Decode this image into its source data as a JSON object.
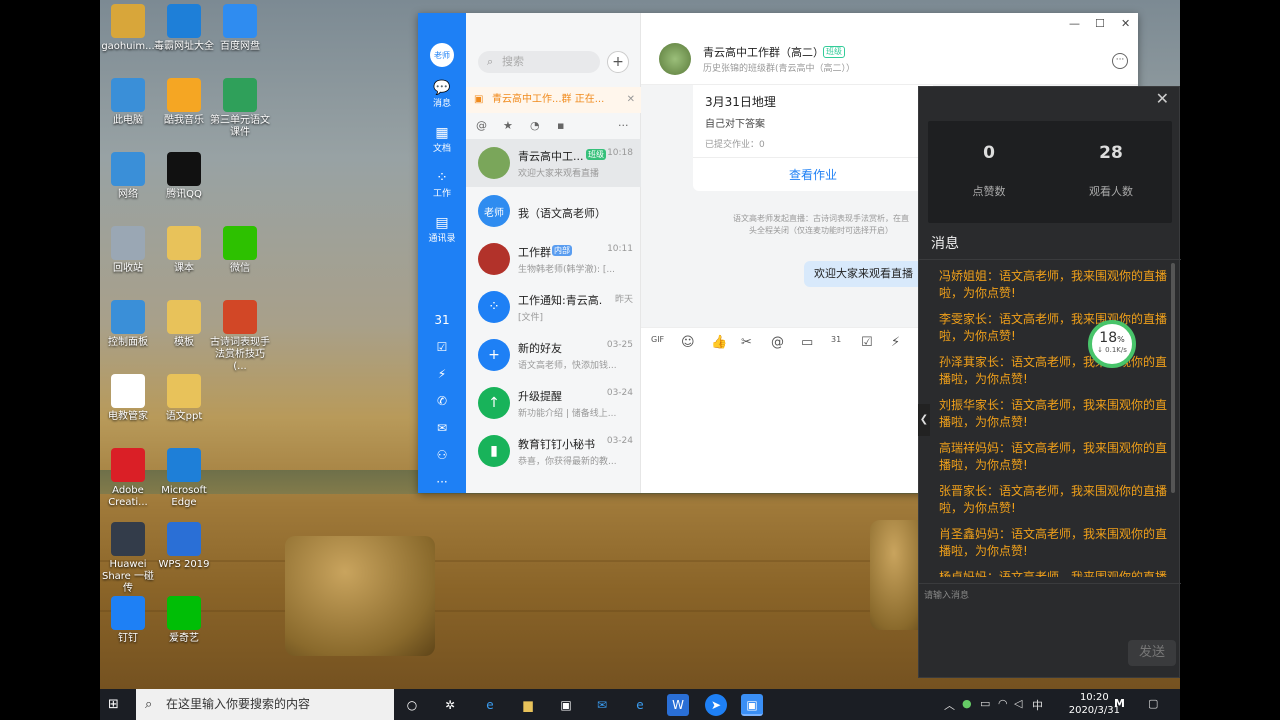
{
  "desktop_icons": [
    {
      "label": "gaohuim...",
      "icon": "user-folder-icon",
      "color": "#d8a63a"
    },
    {
      "label": "毒霸网址大全",
      "icon": "ie-icon",
      "color": "#1e7fd8"
    },
    {
      "label": "百度网盘",
      "icon": "baidu-netdisk-icon",
      "color": "#2f8cf0"
    },
    {
      "label": "此电脑",
      "icon": "computer-icon",
      "color": "#3a8fd8"
    },
    {
      "label": "酷我音乐",
      "icon": "kuwo-icon",
      "color": "#f5a623"
    },
    {
      "label": "第三单元语文课件",
      "icon": "wps-doc-icon",
      "color": "#2fa05a"
    },
    {
      "label": "网络",
      "icon": "network-icon",
      "color": "#3a8fd8"
    },
    {
      "label": "腾讯QQ",
      "icon": "qq-icon",
      "color": "#111111"
    },
    {
      "label": "回收站",
      "icon": "recycle-bin-icon",
      "color": "#9aa7b4"
    },
    {
      "label": "课本",
      "icon": "folder-icon",
      "color": "#e8c25a"
    },
    {
      "label": "微信",
      "icon": "wechat-icon",
      "color": "#2dc100"
    },
    {
      "label": "控制面板",
      "icon": "control-panel-icon",
      "color": "#3a8fd8"
    },
    {
      "label": "模板",
      "icon": "folder-icon",
      "color": "#e8c25a"
    },
    {
      "label": "古诗词表现手法赏析技巧(...",
      "icon": "ppt-icon",
      "color": "#d24726"
    },
    {
      "label": "电教管家",
      "icon": "dianjiao-icon",
      "color": "#ffffff"
    },
    {
      "label": "语文ppt",
      "icon": "folder-icon",
      "color": "#e8c25a"
    },
    {
      "label": "Adobe Creati...",
      "icon": "adobe-icon",
      "color": "#da1f26"
    },
    {
      "label": "Microsoft Edge",
      "icon": "edge-icon",
      "color": "#1e7fd8"
    },
    {
      "label": "Huawei Share 一碰传",
      "icon": "huawei-share-icon",
      "color": "#333c4a"
    },
    {
      "label": "WPS 2019",
      "icon": "wps-icon",
      "color": "#2a6fd6"
    },
    {
      "label": "钉钉",
      "icon": "dingtalk-icon",
      "color": "#1e80f5"
    },
    {
      "label": "爱奇艺",
      "icon": "iqiyi-icon",
      "color": "#00be06"
    }
  ],
  "dingtalk": {
    "avatar_text": "老师",
    "rail": [
      {
        "label": "消息",
        "glyph": "💬",
        "icon": "message-icon"
      },
      {
        "label": "文档",
        "glyph": "▦",
        "icon": "doc-icon"
      },
      {
        "label": "工作",
        "glyph": "⁘",
        "icon": "work-icon"
      },
      {
        "label": "通讯录",
        "glyph": "▤",
        "icon": "contacts-icon"
      }
    ],
    "rail_tools": [
      "31",
      "☑",
      "⚡",
      "✆",
      "✉",
      "⚇",
      "···"
    ],
    "search_placeholder": "搜索",
    "live_notice": "青云高中工作...群 正在...",
    "filters": [
      "@",
      "★",
      "◔",
      "▪",
      "···"
    ],
    "conversations": [
      {
        "name": "青云高中工...",
        "tag": "班级",
        "time": "10:18",
        "preview": "欢迎大家来观看直播",
        "avatar_color": "#7aa65a",
        "avatar_text": ""
      },
      {
        "name": "我（语文高老师）",
        "tag": "",
        "time": "",
        "preview": "",
        "avatar_color": "#2f8cf0",
        "avatar_text": "老师"
      },
      {
        "name": "工作群",
        "tag": "内部",
        "time": "10:11",
        "preview": "生物韩老师(韩学澈): [...",
        "avatar_color": "#b2322a",
        "avatar_text": ""
      },
      {
        "name": "工作通知:青云高...",
        "tag": "",
        "time": "昨天",
        "preview": "[文件]",
        "avatar_color": "#1e80f5",
        "avatar_text": "⁘"
      },
      {
        "name": "新的好友",
        "tag": "",
        "time": "03-25",
        "preview": "语文高老师，快添加钱...",
        "avatar_color": "#1e80f5",
        "avatar_text": "+"
      },
      {
        "name": "升级提醒",
        "tag": "",
        "time": "03-24",
        "preview": "新功能介绍 | 储备线上...",
        "avatar_color": "#18b35a",
        "avatar_text": "↑"
      },
      {
        "name": "教育钉钉小秘书",
        "tag": "",
        "time": "03-24",
        "preview": "恭喜，你获得最新的教...",
        "avatar_color": "#18b35a",
        "avatar_text": "▮"
      }
    ],
    "chat": {
      "title": "青云高中工作群（高二）",
      "tag": "班级",
      "subtitle": "历史张锦的班级群(青云高中（高二））",
      "homework_title": "3月31日地理",
      "homework_desc": "自己对下答案",
      "homework_submitted": "已提交作业：0",
      "homework_button": "查看作业",
      "system_note": "语文高老师发起直播：古诗词表现手法赏析，在直\n头全程关闭（仅连麦功能时可选择开启）",
      "bubble": "欢迎大家来观看直播",
      "tools": [
        "GIF",
        "☺",
        "👍",
        "✂",
        "@",
        "▭",
        "31",
        "☑",
        "⚡"
      ]
    }
  },
  "live_panel": {
    "likes": "0",
    "likes_label": "点赞数",
    "viewers": "28",
    "viewers_label": "观看人数",
    "messages_header": "消息",
    "messages": [
      "冯娇姐姐：语文高老师，我来围观你的直播啦，为你点赞!",
      "李雯家长：语文高老师，我来围观你的直播啦，为你点赞!",
      "孙泽萁家长：语文高老师，我来围观你的直播啦，为你点赞!",
      "刘振华家长：语文高老师，我来围观你的直播啦，为你点赞!",
      "高瑞祥妈妈：语文高老师，我来围观你的直播啦，为你点赞!",
      "张晋家长：语文高老师，我来围观你的直播啦，为你点赞!",
      "肖圣鑫妈妈：语文高老师，我来围观你的直播啦，为你点赞!",
      "杨卓妈妈：语文高老师，我来围观你的直播"
    ],
    "input_placeholder": "请输入消息",
    "send_label": "发送"
  },
  "net_badge": {
    "percent": "18",
    "unit": "%",
    "speed": "↓ 0.1K/s"
  },
  "taskbar": {
    "search_placeholder": "在这里输入你要搜索的内容",
    "ime": "中",
    "time": "10:20",
    "date": "2020/3/31"
  }
}
